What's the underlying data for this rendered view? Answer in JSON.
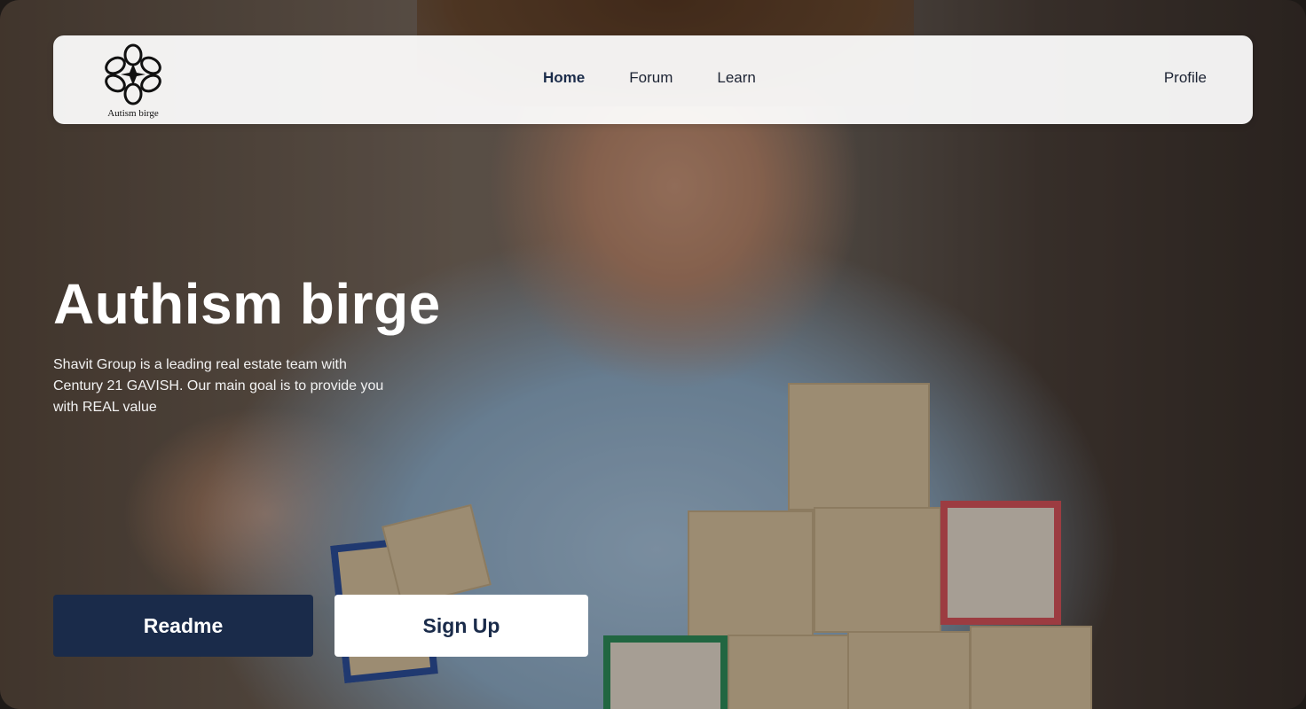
{
  "brand": {
    "logo_text": "Autism birge",
    "logo_icon": "flower-puzzle-icon"
  },
  "nav": {
    "items": [
      {
        "label": "Home",
        "active": true
      },
      {
        "label": "Forum",
        "active": false
      },
      {
        "label": "Learn",
        "active": false
      }
    ],
    "profile_label": "Profile"
  },
  "hero": {
    "title": "Authism birge",
    "description": "Shavit Group is a leading real estate team with Century 21 GAVISH. Our main goal is to provide you with REAL value",
    "primary_button": "Readme",
    "secondary_button": "Sign Up"
  },
  "colors": {
    "primary": "#1a2b4a",
    "on_primary": "#ffffff",
    "navbar_bg": "#f5f5f5"
  }
}
